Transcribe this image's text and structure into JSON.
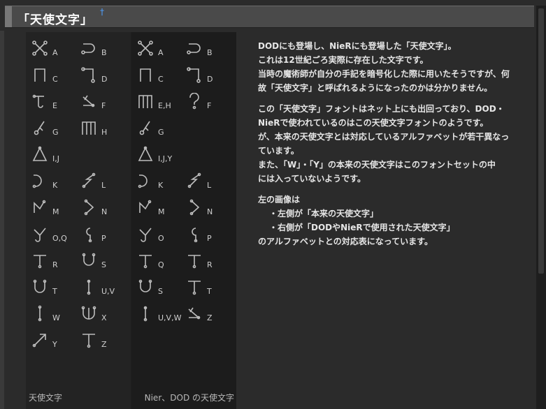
{
  "header": {
    "title": "「天使文字」",
    "dagger": "†"
  },
  "chart": {
    "caption_left": "天使文字",
    "caption_right": "Nier、DOD の天使文字",
    "left_glyphs": [
      {
        "a": {
          "label": "A",
          "icon": "cross-circles-icon"
        },
        "b": {
          "label": "B",
          "icon": "hook-circle-icon"
        }
      },
      {
        "a": {
          "label": "C",
          "icon": "gate-icon"
        },
        "b": {
          "label": "D",
          "icon": "bracket-icon"
        }
      },
      {
        "a": {
          "label": "E",
          "icon": "t-hook-icon"
        },
        "b": {
          "label": "F",
          "icon": "diag-check-icon"
        }
      },
      {
        "a": {
          "label": "G",
          "icon": "slash-circle-icon"
        },
        "b": {
          "label": "H",
          "icon": "double-gate-icon"
        }
      },
      {
        "a": {
          "label": "I,J",
          "icon": "triangle-icon"
        },
        "b": null
      },
      {
        "a": {
          "label": "K",
          "icon": "c-hook-icon"
        },
        "b": {
          "label": "L",
          "icon": "squiggle-icon"
        }
      },
      {
        "a": {
          "label": "M",
          "icon": "zigzag-icon"
        },
        "b": {
          "label": "N",
          "icon": "chevron-icon"
        }
      },
      {
        "a": {
          "label": "O,Q",
          "icon": "y-curl-icon"
        },
        "b": {
          "label": "P",
          "icon": "curl-icon"
        }
      },
      {
        "a": {
          "label": "R",
          "icon": "bar-stem-icon"
        },
        "b": {
          "label": "S",
          "icon": "bowl-icon"
        }
      },
      {
        "a": {
          "label": "T",
          "icon": "u-ring-icon"
        },
        "b": {
          "label": "U,V",
          "icon": "stem-icon"
        }
      },
      {
        "a": {
          "label": "W",
          "icon": "line-icon"
        },
        "b": {
          "label": "X",
          "icon": "trident-icon"
        }
      },
      {
        "a": {
          "label": "Y",
          "icon": "arrow-icon"
        },
        "b": {
          "label": "Z",
          "icon": "t-stem-icon"
        }
      }
    ],
    "right_glyphs": [
      {
        "a": {
          "label": "A",
          "icon": "cross-circles-icon"
        },
        "b": {
          "label": "B",
          "icon": "hook-circle-icon"
        }
      },
      {
        "a": {
          "label": "C",
          "icon": "gate-icon"
        },
        "b": {
          "label": "D",
          "icon": "bracket-icon"
        }
      },
      {
        "a": {
          "label": "E,H",
          "icon": "double-gate-icon"
        },
        "b": {
          "label": "F",
          "icon": "question-icon"
        }
      },
      {
        "a": {
          "label": "G",
          "icon": "slash-circle-icon"
        },
        "b": null
      },
      {
        "a": {
          "label": "I,J,Y",
          "icon": "triangle-icon"
        },
        "b": null
      },
      {
        "a": {
          "label": "K",
          "icon": "c-hook-icon"
        },
        "b": {
          "label": "L",
          "icon": "squiggle-icon"
        }
      },
      {
        "a": {
          "label": "M",
          "icon": "zigzag-icon"
        },
        "b": {
          "label": "N",
          "icon": "chevron-icon"
        }
      },
      {
        "a": {
          "label": "O",
          "icon": "y-curl-icon"
        },
        "b": {
          "label": "P",
          "icon": "curl-icon"
        }
      },
      {
        "a": {
          "label": "Q",
          "icon": "bar-stem-icon"
        },
        "b": {
          "label": "R",
          "icon": "bar-stem-icon"
        }
      },
      {
        "a": {
          "label": "S",
          "icon": "bowl-icon"
        },
        "b": {
          "label": "T",
          "icon": "t-stem-icon"
        }
      },
      {
        "a": {
          "label": "U,V,W",
          "icon": "stem-icon"
        },
        "b": {
          "label": "Z",
          "icon": "diag-check-icon"
        }
      }
    ]
  },
  "content": {
    "p1": [
      "DODにも登場し、NieRにも登場した「天使文字」。",
      "これは12世紀ごろ実際に存在した文字です。",
      "当時の魔術師が自分の手記を暗号化した際に用いたそうですが、何",
      "故「天使文字」と呼ばれるようになったのかは分かりません。"
    ],
    "p2": [
      "この「天使文字」フォントはネット上にも出回っており、DOD・",
      "NieRで使われているのはこの天使文字フォントのようです。",
      "が、本来の天使文字とは対応しているアルファベットが若干異なっ",
      "ています。",
      "また、「W」・「Y」の本来の天使文字はこのフォントセットの中",
      "には入っていないようです。"
    ],
    "p3_intro": "左の画像は",
    "p3_item1": "・左側が「本来の天使文字」",
    "p3_item2": "・右側が「DODやNieRで使用された天使文字」",
    "p3_outro": "のアルファベットとの対応表になっています。"
  }
}
